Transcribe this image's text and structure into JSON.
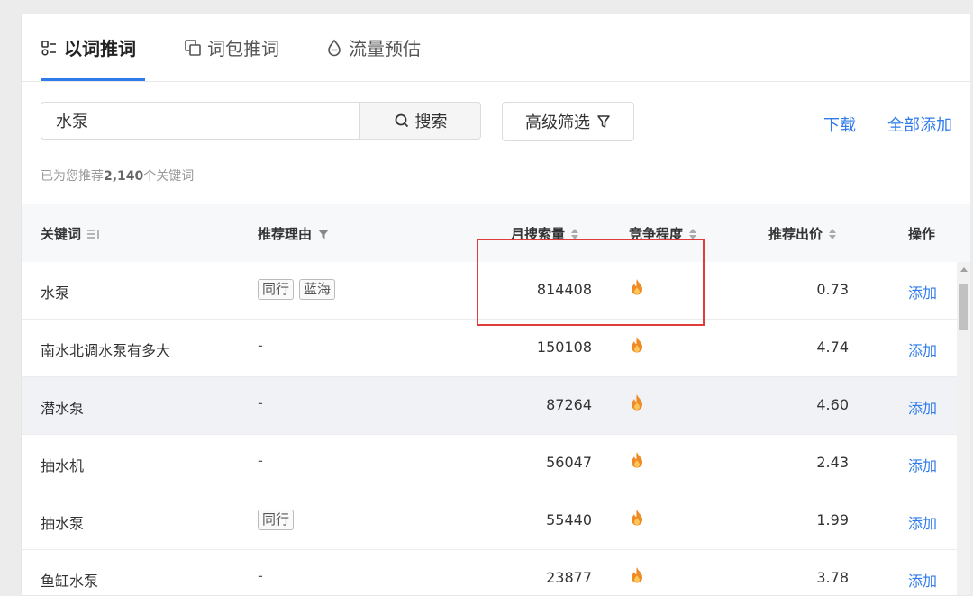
{
  "tabs": [
    {
      "label": "以词推词",
      "icon": "keyword-icon",
      "active": true
    },
    {
      "label": "词包推词",
      "icon": "package-icon",
      "active": false
    },
    {
      "label": "流量预估",
      "icon": "drop-icon",
      "active": false
    }
  ],
  "search": {
    "value": "水泵",
    "button_label": "搜索"
  },
  "filter": {
    "label": "高级筛选"
  },
  "actions": {
    "download": "下载",
    "add_all": "全部添加"
  },
  "summary": {
    "prefix": "已为您推荐",
    "count": "2,140",
    "suffix": "个关键词"
  },
  "table": {
    "headers": {
      "keyword": "关键词",
      "reason": "推荐理由",
      "volume": "月搜索量",
      "competition": "竞争程度",
      "bid": "推荐出价",
      "action": "操作"
    },
    "rows": [
      {
        "keyword": "水泵",
        "tags": [
          "同行",
          "蓝海"
        ],
        "reason": "",
        "volume": "814408",
        "competition": "fire-icon",
        "bid": "0.73",
        "action": "添加"
      },
      {
        "keyword": "南水北调水泵有多大",
        "tags": [],
        "reason": "-",
        "volume": "150108",
        "competition": "fire-icon",
        "bid": "4.74",
        "action": "添加"
      },
      {
        "keyword": "潜水泵",
        "tags": [],
        "reason": "-",
        "volume": "87264",
        "competition": "fire-icon",
        "bid": "4.60",
        "action": "添加"
      },
      {
        "keyword": "抽水机",
        "tags": [],
        "reason": "-",
        "volume": "56047",
        "competition": "fire-icon",
        "bid": "2.43",
        "action": "添加"
      },
      {
        "keyword": "抽水泵",
        "tags": [
          "同行"
        ],
        "reason": "",
        "volume": "55440",
        "competition": "fire-icon",
        "bid": "1.99",
        "action": "添加"
      },
      {
        "keyword": "鱼缸水泵",
        "tags": [],
        "reason": "-",
        "volume": "23877",
        "competition": "fire-icon",
        "bid": "3.78",
        "action": "添加"
      }
    ]
  },
  "colors": {
    "accent": "#2f7bea",
    "highlight": "#e03c3c",
    "fire": "#f08a24"
  }
}
